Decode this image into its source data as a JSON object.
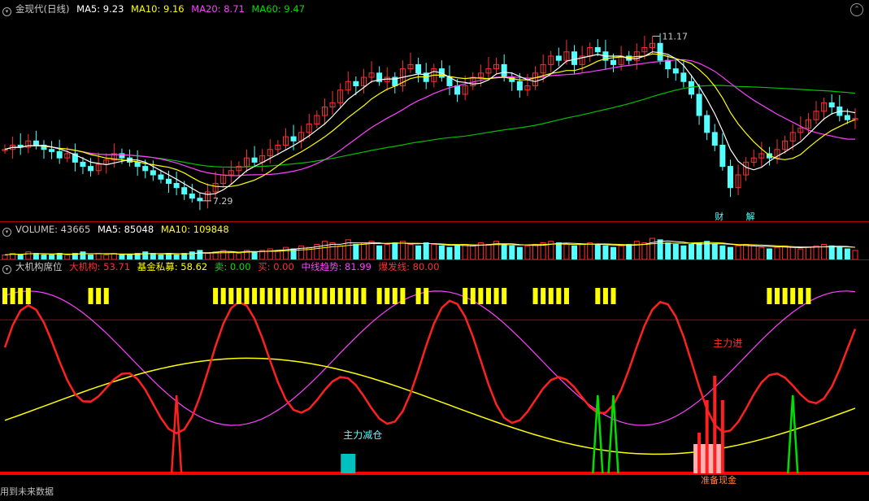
{
  "main_header": {
    "title": "金现代(日线)",
    "ma5": "MA5: 9.23",
    "ma10": "MA10: 9.16",
    "ma20": "MA20: 8.71",
    "ma60": "MA60: 9.47"
  },
  "vol_header": {
    "volume": "VOLUME: 43665",
    "ma5": "MA5: 85048",
    "ma10": "MA10: 109848"
  },
  "ind_header": {
    "name": "大机构席位",
    "big_inst": "大机构: 53.71",
    "fund": "基金私募: 58.62",
    "sell": "卖: 0.00",
    "buy": "买: 0.00",
    "mid_trend": "中线趋势: 81.99",
    "burst": "爆发线: 80.00"
  },
  "annotations": {
    "high_price": "11.17",
    "low_price": "7.29",
    "finance_label": "财",
    "unlock_label": "解",
    "main_reduce": "主力减仓",
    "main_enter": "主力进",
    "prepare_cash": "准备现金"
  },
  "footer": {
    "text": "用到未来数据"
  },
  "colors": {
    "up": "#ff3030",
    "down": "#54ffff",
    "ma5": "#ffffff",
    "ma10": "#ffff00",
    "ma20": "#ff40ff",
    "ma60": "#00c000"
  },
  "chart_data": {
    "type": "candlestick",
    "close_series": [
      8.5,
      8.6,
      8.55,
      8.7,
      8.6,
      8.5,
      8.45,
      8.3,
      8.4,
      8.2,
      8.1,
      8.0,
      8.15,
      8.25,
      8.4,
      8.3,
      8.2,
      8.1,
      8.0,
      7.9,
      7.8,
      7.7,
      7.6,
      7.45,
      7.35,
      7.29,
      7.5,
      7.7,
      7.9,
      8.0,
      8.1,
      8.3,
      8.2,
      8.35,
      8.5,
      8.6,
      8.8,
      8.7,
      8.9,
      9.1,
      9.3,
      9.5,
      9.6,
      9.9,
      10.1,
      10.0,
      10.2,
      10.3,
      10.1,
      10.2,
      10.0,
      10.4,
      10.5,
      10.3,
      10.1,
      10.4,
      10.2,
      10.0,
      9.8,
      10.0,
      10.2,
      10.3,
      10.4,
      10.5,
      10.2,
      10.1,
      9.9,
      10.0,
      10.3,
      10.5,
      10.7,
      10.6,
      10.8,
      10.5,
      10.7,
      10.9,
      10.8,
      10.6,
      10.5,
      10.7,
      10.6,
      10.8,
      10.9,
      11.0,
      10.6,
      10.4,
      10.3,
      10.1,
      9.8,
      9.3,
      8.9,
      8.6,
      8.1,
      7.6,
      7.9,
      8.2,
      8.3,
      8.4,
      8.3,
      8.5,
      8.7,
      8.9,
      9.0,
      9.2,
      9.4,
      9.6,
      9.5,
      9.3,
      9.2,
      9.23
    ],
    "volume_series": [
      3,
      4,
      3,
      5,
      4,
      3,
      3,
      4,
      3,
      4,
      5,
      3,
      4,
      3,
      4,
      3,
      3,
      4,
      5,
      4,
      3,
      4,
      3,
      4,
      5,
      6,
      4,
      5,
      6,
      5,
      4,
      6,
      5,
      6,
      7,
      6,
      8,
      7,
      9,
      8,
      10,
      12,
      11,
      9,
      13,
      10,
      11,
      12,
      9,
      10,
      11,
      12,
      10,
      9,
      11,
      10,
      9,
      8,
      9,
      10,
      9,
      11,
      10,
      12,
      10,
      9,
      8,
      9,
      10,
      11,
      12,
      11,
      10,
      9,
      10,
      11,
      10,
      9,
      8,
      9,
      10,
      12,
      11,
      14,
      13,
      11,
      10,
      9,
      10,
      11,
      12,
      10,
      9,
      8,
      9,
      10,
      9,
      8,
      7,
      8,
      9,
      8,
      7,
      8,
      9,
      10,
      9,
      8,
      7,
      6
    ],
    "indicator": {
      "big_inst": 53.71,
      "fund": 58.62,
      "sell": 0.0,
      "buy": 0.0,
      "mid_trend": 81.99,
      "burst": 80.0
    }
  }
}
